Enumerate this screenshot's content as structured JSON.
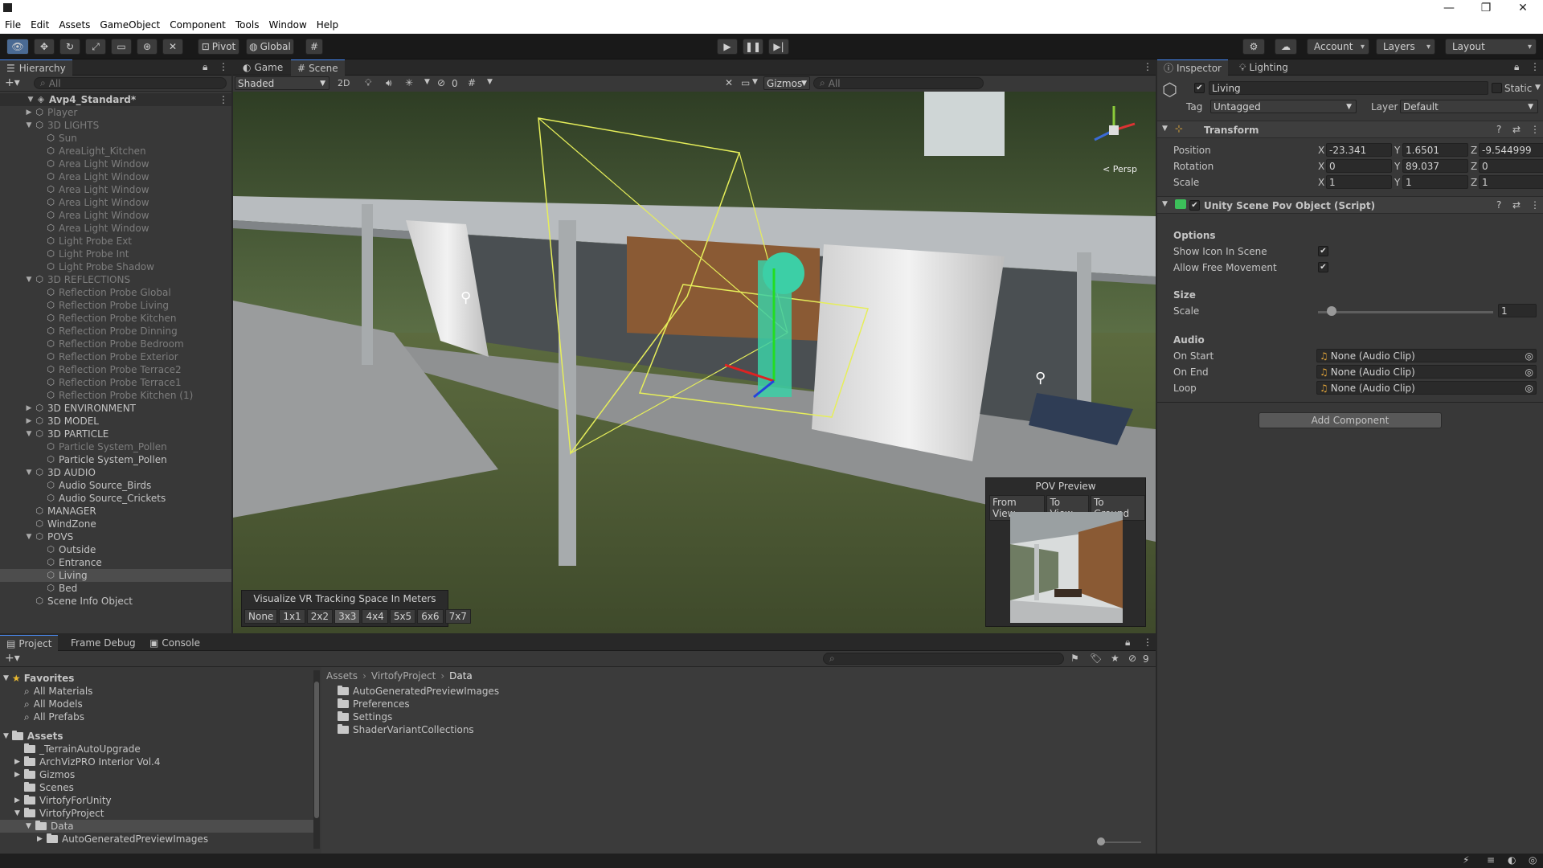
{
  "menu": [
    "File",
    "Edit",
    "Assets",
    "GameObject",
    "Component",
    "Tools",
    "Window",
    "Help"
  ],
  "toolbar": {
    "pivot": "Pivot",
    "global": "Global",
    "account": "Account",
    "layers": "Layers",
    "layout": "Layout"
  },
  "hierarchy": {
    "tab": "Hierarchy",
    "search_placeholder": "All",
    "scene_name": "Avp4_Standard*",
    "items": [
      {
        "label": "Player",
        "indent": 1,
        "arrow": "▶",
        "dim": true
      },
      {
        "label": "3D LIGHTS",
        "indent": 1,
        "arrow": "▼",
        "dim": true
      },
      {
        "label": "Sun",
        "indent": 2,
        "arrow": "",
        "dim": true
      },
      {
        "label": "AreaLight_Kitchen",
        "indent": 2,
        "arrow": "",
        "dim": true
      },
      {
        "label": "Area Light Window",
        "indent": 2,
        "arrow": "",
        "dim": true
      },
      {
        "label": "Area Light Window",
        "indent": 2,
        "arrow": "",
        "dim": true
      },
      {
        "label": "Area Light Window",
        "indent": 2,
        "arrow": "",
        "dim": true
      },
      {
        "label": "Area Light Window",
        "indent": 2,
        "arrow": "",
        "dim": true
      },
      {
        "label": "Area Light Window",
        "indent": 2,
        "arrow": "",
        "dim": true
      },
      {
        "label": "Area Light Window",
        "indent": 2,
        "arrow": "",
        "dim": true
      },
      {
        "label": "Light Probe Ext",
        "indent": 2,
        "arrow": "",
        "dim": true
      },
      {
        "label": "Light Probe Int",
        "indent": 2,
        "arrow": "",
        "dim": true
      },
      {
        "label": "Light Probe Shadow",
        "indent": 2,
        "arrow": "",
        "dim": true
      },
      {
        "label": "3D REFLECTIONS",
        "indent": 1,
        "arrow": "▼",
        "dim": true
      },
      {
        "label": "Reflection Probe Global",
        "indent": 2,
        "arrow": "",
        "dim": true
      },
      {
        "label": "Reflection Probe Living",
        "indent": 2,
        "arrow": "",
        "dim": true
      },
      {
        "label": "Reflection Probe Kitchen",
        "indent": 2,
        "arrow": "",
        "dim": true
      },
      {
        "label": "Reflection Probe Dinning",
        "indent": 2,
        "arrow": "",
        "dim": true
      },
      {
        "label": "Reflection Probe Bedroom",
        "indent": 2,
        "arrow": "",
        "dim": true
      },
      {
        "label": "Reflection Probe Exterior",
        "indent": 2,
        "arrow": "",
        "dim": true
      },
      {
        "label": "Reflection Probe Terrace2",
        "indent": 2,
        "arrow": "",
        "dim": true
      },
      {
        "label": "Reflection Probe Terrace1",
        "indent": 2,
        "arrow": "",
        "dim": true
      },
      {
        "label": "Reflection Probe Kitchen (1)",
        "indent": 2,
        "arrow": "",
        "dim": true
      },
      {
        "label": "3D ENVIRONMENT",
        "indent": 1,
        "arrow": "▶",
        "dim": false
      },
      {
        "label": "3D MODEL",
        "indent": 1,
        "arrow": "▶",
        "dim": false
      },
      {
        "label": "3D PARTICLE",
        "indent": 1,
        "arrow": "▼",
        "dim": false
      },
      {
        "label": "Particle System_Pollen",
        "indent": 2,
        "arrow": "",
        "dim": true
      },
      {
        "label": "Particle System_Pollen",
        "indent": 2,
        "arrow": "",
        "dim": false
      },
      {
        "label": "3D AUDIO",
        "indent": 1,
        "arrow": "▼",
        "dim": false
      },
      {
        "label": "Audio Source_Birds",
        "indent": 2,
        "arrow": "",
        "dim": false
      },
      {
        "label": "Audio Source_Crickets",
        "indent": 2,
        "arrow": "",
        "dim": false
      },
      {
        "label": "MANAGER",
        "indent": 1,
        "arrow": "",
        "dim": false
      },
      {
        "label": "WindZone",
        "indent": 1,
        "arrow": "",
        "dim": false
      },
      {
        "label": "POVS",
        "indent": 1,
        "arrow": "▼",
        "dim": false
      },
      {
        "label": "Outside",
        "indent": 2,
        "arrow": "",
        "dim": false
      },
      {
        "label": "Entrance",
        "indent": 2,
        "arrow": "",
        "dim": false
      },
      {
        "label": "Living",
        "indent": 2,
        "arrow": "",
        "dim": false,
        "selected": true
      },
      {
        "label": "Bed",
        "indent": 2,
        "arrow": "",
        "dim": false
      },
      {
        "label": "Scene Info Object",
        "indent": 1,
        "arrow": "",
        "dim": false
      }
    ]
  },
  "scene_view": {
    "tabs": [
      "Game",
      "Scene"
    ],
    "shading": "Shaded",
    "mode_2d": "2D",
    "hidden_count": "0",
    "gizmos": "Gizmos",
    "search_placeholder": "All",
    "persp": "< Persp",
    "vr_panel": {
      "title": "Visualize VR Tracking Space In Meters",
      "options": [
        "None",
        "1x1",
        "2x2",
        "3x3",
        "4x4",
        "5x5",
        "6x6",
        "7x7"
      ],
      "selected": "3x3"
    },
    "pov_preview": {
      "title": "POV Preview",
      "buttons": [
        "From View",
        "To View",
        "To Ground"
      ]
    }
  },
  "inspector": {
    "tabs": [
      "Inspector",
      "Lighting"
    ],
    "object_name": "Living",
    "static_label": "Static",
    "tag_label": "Tag",
    "tag_value": "Untagged",
    "layer_label": "Layer",
    "layer_value": "Default",
    "transform": {
      "title": "Transform",
      "rows": [
        {
          "label": "Position",
          "x": "-23.341",
          "y": "1.6501",
          "z": "-9.544999"
        },
        {
          "label": "Rotation",
          "x": "0",
          "y": "89.037",
          "z": "0"
        },
        {
          "label": "Scale",
          "x": "1",
          "y": "1",
          "z": "1"
        }
      ]
    },
    "script": {
      "title": "Unity Scene Pov Object (Script)",
      "options_header": "Options",
      "show_icon": "Show Icon In Scene",
      "allow_free": "Allow Free Movement",
      "size_header": "Size",
      "scale_label": "Scale",
      "scale_value": "1",
      "audio_header": "Audio",
      "on_start": "On Start",
      "on_end": "On End",
      "loop": "Loop",
      "audio_value": "None (Audio Clip)"
    },
    "add_component": "Add Component"
  },
  "bottom": {
    "tabs": [
      "Project",
      "Frame Debug",
      "Console"
    ],
    "hidden_count": "9",
    "favorites_title": "Favorites",
    "favorites": [
      "All Materials",
      "All Models",
      "All Prefabs"
    ],
    "assets_title": "Assets",
    "assets_tree": [
      {
        "label": "_TerrainAutoUpgrade",
        "indent": 1,
        "arrow": ""
      },
      {
        "label": "ArchVizPRO Interior Vol.4",
        "indent": 1,
        "arrow": "▶"
      },
      {
        "label": "Gizmos",
        "indent": 1,
        "arrow": "▶"
      },
      {
        "label": "Scenes",
        "indent": 1,
        "arrow": ""
      },
      {
        "label": "VirtofyForUnity",
        "indent": 1,
        "arrow": "▶"
      },
      {
        "label": "VirtofyProject",
        "indent": 1,
        "arrow": "▼"
      },
      {
        "label": "Data",
        "indent": 2,
        "arrow": "▼",
        "selected": true
      },
      {
        "label": "AutoGeneratedPreviewImages",
        "indent": 3,
        "arrow": "▶"
      }
    ],
    "breadcrumb": [
      "Assets",
      "VirtofyProject",
      "Data"
    ],
    "files": [
      "AutoGeneratedPreviewImages",
      "Preferences",
      "Settings",
      "ShaderVariantCollections"
    ]
  }
}
